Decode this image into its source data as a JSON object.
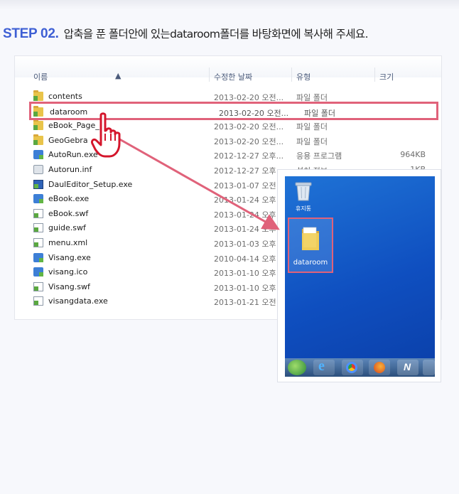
{
  "heading": {
    "step_label": "STEP 02.",
    "instruction": "압축을 푼 폴더안에 있는dataroom폴더를 바탕화면에 복사해 주세요."
  },
  "explorer": {
    "columns": {
      "name": "이름",
      "date": "수정한 날짜",
      "type": "유형",
      "size": "크기"
    },
    "files": [
      {
        "icon": "folder-icon",
        "name": "contents",
        "date": "2013-02-20 오전...",
        "type": "파일 폴더",
        "size": ""
      },
      {
        "icon": "folder-icon",
        "name": "dataroom",
        "date": "2013-02-20 오전...",
        "type": "파일 폴더",
        "size": ""
      },
      {
        "icon": "folder-icon",
        "name": "eBook_Page_",
        "date": "2013-02-20 오전...",
        "type": "파일 폴더",
        "size": ""
      },
      {
        "icon": "folder-icon",
        "name": "GeoGebra",
        "date": "2013-02-20 오전...",
        "type": "파일 폴더",
        "size": ""
      },
      {
        "icon": "exe-icon",
        "name": "AutoRun.exe",
        "date": "2012-12-27 오후...",
        "type": "응용 프로그램",
        "size": "964KB"
      },
      {
        "icon": "inf-icon",
        "name": "Autorun.inf",
        "date": "2012-12-27 오후",
        "type": "설치 정보",
        "size": "1KB"
      },
      {
        "icon": "setup-icon",
        "name": "DaulEditor_Setup.exe",
        "date": "2013-01-07 오전",
        "type": "",
        "size": ""
      },
      {
        "icon": "exe-icon",
        "name": "eBook.exe",
        "date": "2013-01-24 오후",
        "type": "",
        "size": ""
      },
      {
        "icon": "file-icon",
        "name": "eBook.swf",
        "date": "2013-01-24 오후",
        "type": "",
        "size": ""
      },
      {
        "icon": "file-icon",
        "name": "guide.swf",
        "date": "2013-01-24 오후",
        "type": "",
        "size": ""
      },
      {
        "icon": "file-icon",
        "name": "menu.xml",
        "date": "2013-01-03 오후",
        "type": "",
        "size": ""
      },
      {
        "icon": "exe-icon",
        "name": "Visang.exe",
        "date": "2010-04-14 오후",
        "type": "",
        "size": ""
      },
      {
        "icon": "exe-icon",
        "name": "visang.ico",
        "date": "2013-01-10 오후",
        "type": "",
        "size": ""
      },
      {
        "icon": "file-icon",
        "name": "Visang.swf",
        "date": "2013-01-10 오후",
        "type": "",
        "size": ""
      },
      {
        "icon": "file-icon",
        "name": "visangdata.exe",
        "date": "2013-01-21 오전",
        "type": "",
        "size": ""
      }
    ]
  },
  "desktop": {
    "recycle_bin_label": "휴지통",
    "folder_label": "dataroom"
  },
  "colors": {
    "accent": "#3e5fd4",
    "highlight": "#e0627a",
    "desktop_bg": "#0f4fc0"
  }
}
